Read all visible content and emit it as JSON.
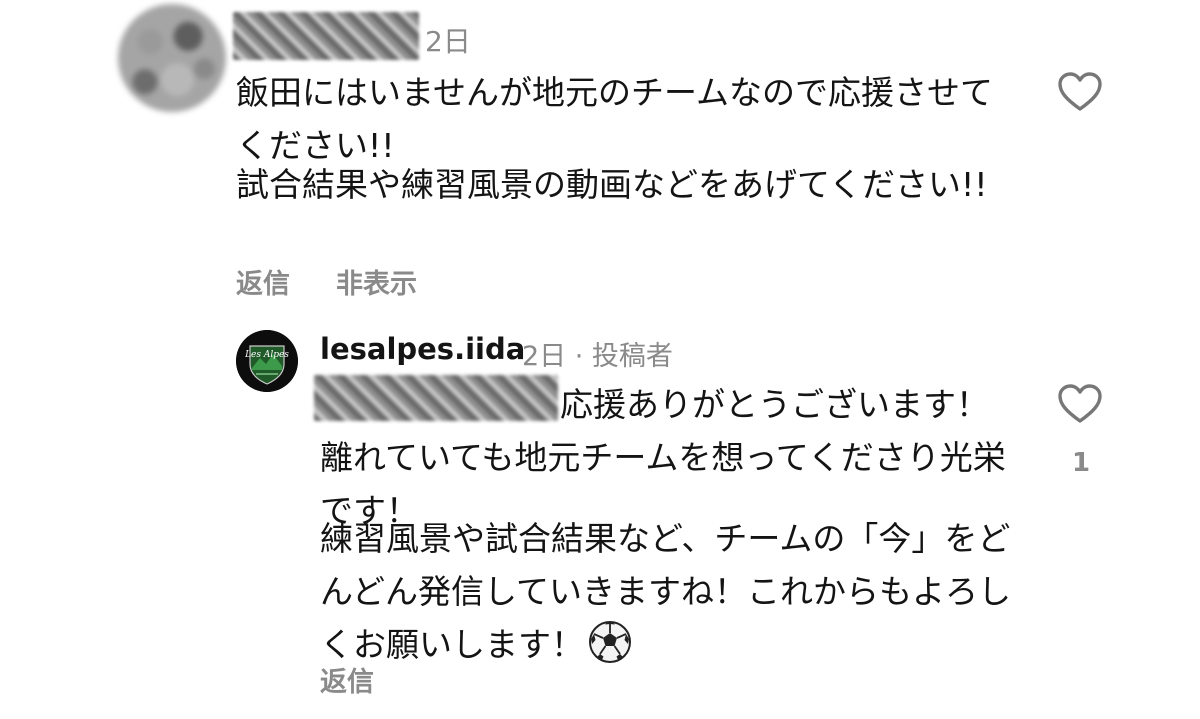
{
  "comment": {
    "time": "2日",
    "paragraph1": "飯田にはいませんが地元のチームなので応援させてください!!",
    "paragraph2": "試合結果や練習風景の動画などをあげてください!!",
    "actions": {
      "reply": "返信",
      "hide": "非表示"
    }
  },
  "reply": {
    "username": "lesalpes.iida",
    "meta": "2日 · 投稿者",
    "paragraph1": "応援ありがとうございます！離れていても地元チームを想ってくださり光栄です！",
    "paragraph2": "練習風景や試合結果など、チームの「今」をどんどん発信していきますね！これからもよろしくお願いします！",
    "emoji": "soccer-ball",
    "like_count": "1",
    "actions": {
      "reply": "返信"
    },
    "avatar_logo_text": "Les Alpes"
  },
  "colors": {
    "text_primary": "#141414",
    "text_secondary": "#8a8a8a",
    "background": "#ffffff",
    "logo_green": "#2f7a3a"
  },
  "icons": {
    "like": "heart-outline-icon",
    "emoji": "soccer-ball-icon"
  }
}
